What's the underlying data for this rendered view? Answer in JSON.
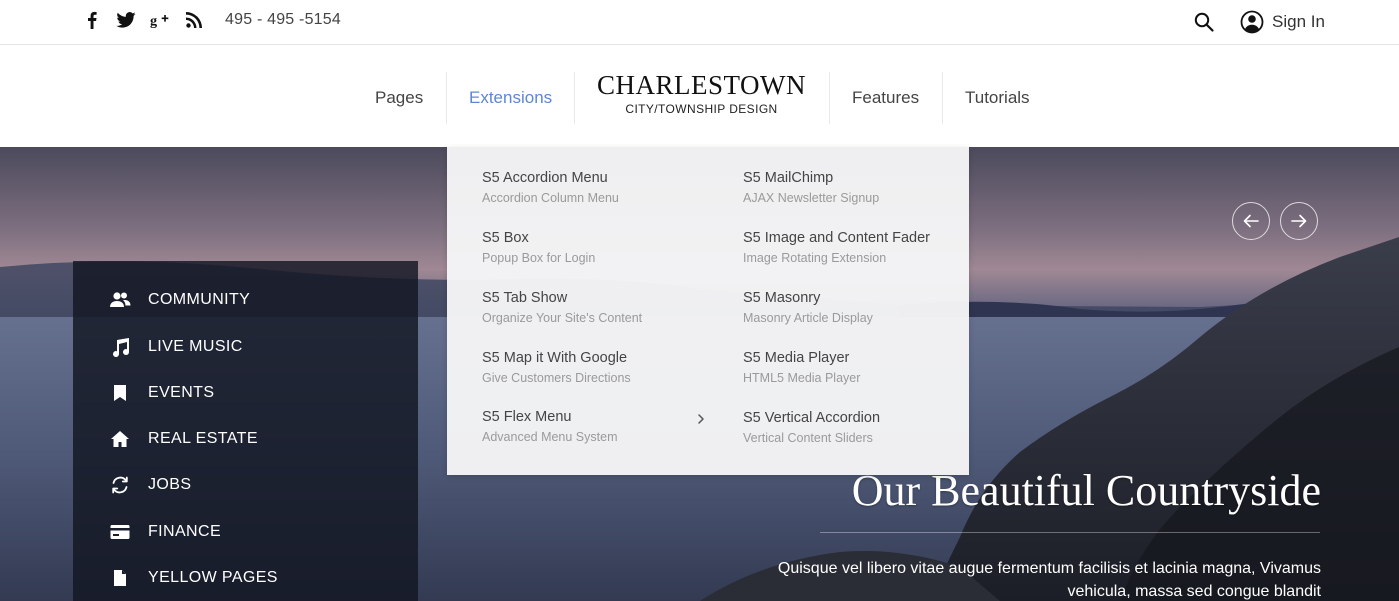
{
  "topbar": {
    "social_icons": [
      "facebook-icon",
      "twitter-icon",
      "google-plus-icon",
      "rss-icon"
    ],
    "phone": "495 - 495 -5154",
    "signin_label": "Sign In"
  },
  "nav": {
    "items": [
      {
        "label": "Pages",
        "active": false
      },
      {
        "label": "Extensions",
        "active": true
      },
      {
        "label": "Features",
        "active": false
      },
      {
        "label": "Tutorials",
        "active": false
      }
    ],
    "logo_title": "CHARLESTOWN",
    "logo_subtitle": "CITY/TOWNSHIP DESIGN",
    "accent_color": "#5b87d6"
  },
  "dropdown": {
    "left_column": [
      {
        "title": "S5 Accordion Menu",
        "subtitle": "Accordion Column Menu"
      },
      {
        "title": "S5 Box",
        "subtitle": "Popup Box for Login"
      },
      {
        "title": "S5 Tab Show",
        "subtitle": "Organize Your Site's Content"
      },
      {
        "title": "S5 Map it With Google",
        "subtitle": "Give Customers Directions"
      },
      {
        "title": "S5 Flex Menu",
        "subtitle": "Advanced Menu System",
        "has_submenu": true
      }
    ],
    "right_column": [
      {
        "title": "S5 MailChimp",
        "subtitle": "AJAX Newsletter Signup"
      },
      {
        "title": "S5 Image and Content Fader",
        "subtitle": "Image Rotating Extension"
      },
      {
        "title": "S5 Masonry",
        "subtitle": "Masonry Article Display"
      },
      {
        "title": "S5 Media Player",
        "subtitle": "HTML5 Media Player"
      },
      {
        "title": "S5 Vertical Accordion",
        "subtitle": "Vertical Content Sliders"
      }
    ]
  },
  "sidebar": {
    "items": [
      {
        "label": "COMMUNITY",
        "icon": "community-icon"
      },
      {
        "label": "LIVE MUSIC",
        "icon": "music-note-icon"
      },
      {
        "label": "EVENTS",
        "icon": "bookmark-icon"
      },
      {
        "label": "REAL ESTATE",
        "icon": "home-icon"
      },
      {
        "label": "JOBS",
        "icon": "refresh-icon"
      },
      {
        "label": "FINANCE",
        "icon": "credit-card-icon"
      },
      {
        "label": "YELLOW PAGES",
        "icon": "document-icon"
      }
    ]
  },
  "hero": {
    "title": "Our Beautiful Countryside",
    "text": "Quisque vel libero vitae augue fermentum facilisis et lacinia magna, Vivamus vehicula, massa sed congue blandit"
  }
}
